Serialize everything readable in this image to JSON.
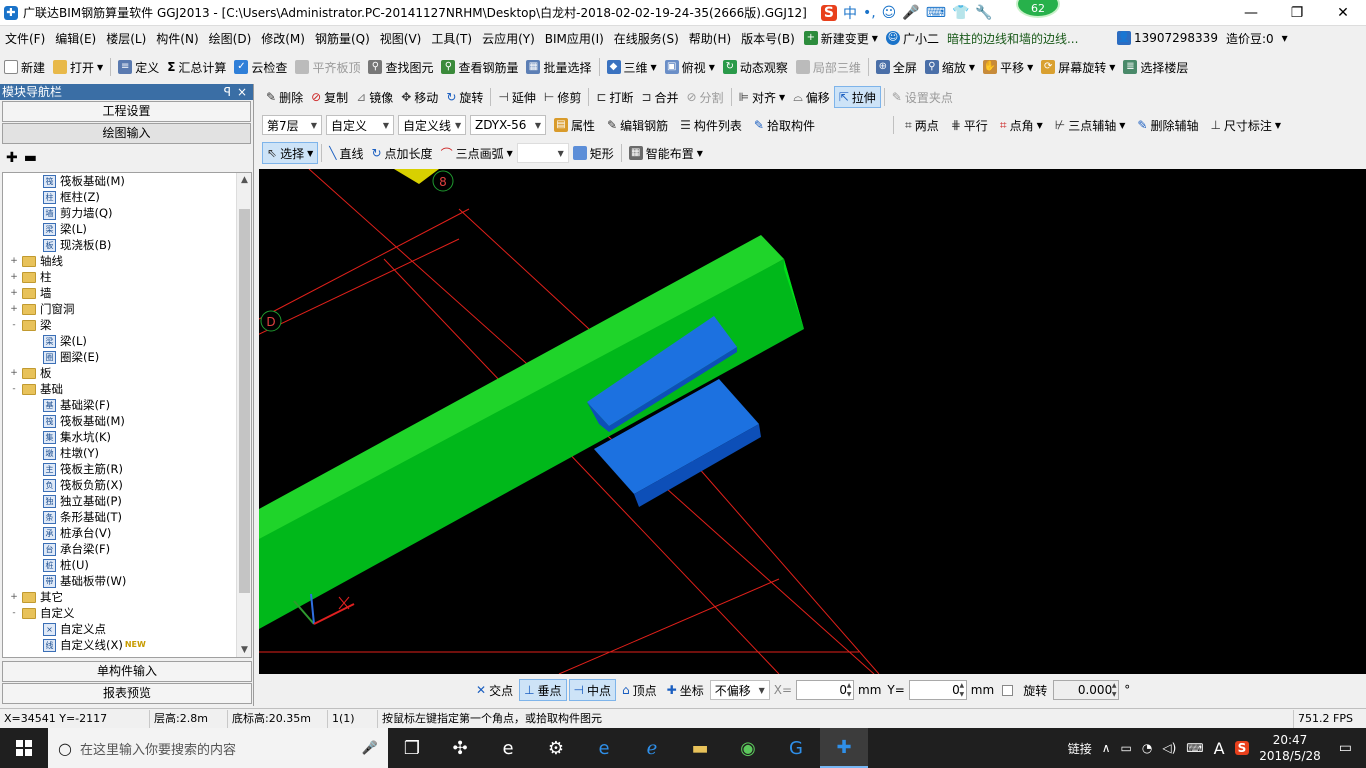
{
  "title": {
    "text": "广联达BIM钢筋算量软件 GGJ2013 - [C:\\Users\\Administrator.PC-20141127NRHM\\Desktop\\白龙村-2018-02-02-19-24-35(2666版).GGJ12]",
    "badge": "62",
    "ime_icons": [
      "S",
      "中",
      "•,",
      "☺",
      "🎤",
      "⌨",
      "👕",
      "🔧"
    ]
  },
  "menu": {
    "items": [
      "文件(F)",
      "编辑(E)",
      "楼层(L)",
      "构件(N)",
      "绘图(D)",
      "修改(M)",
      "钢筋量(Q)",
      "视图(V)",
      "工具(T)",
      "云应用(Y)",
      "BIM应用(I)",
      "在线服务(S)",
      "帮助(H)",
      "版本号(B)"
    ],
    "new_change": "新建变更",
    "guangxiaoer": "广小二",
    "marquee": "暗柱的边线和墙的边线...",
    "phone": "13907298339",
    "price_bean": "造价豆:0"
  },
  "toolbar1": {
    "new": "新建",
    "open": "打开",
    "define": "定义",
    "sum": "汇总计算",
    "cloud_check": "云检查",
    "flush_top": "平齐板顶",
    "find_elem": "查找图元",
    "view_steel": "查看钢筋量",
    "batch_select": "批量选择",
    "view3d": "三维",
    "top_view": "俯视",
    "dynamic_view": "动态观察",
    "local3d": "局部三维",
    "fullscreen": "全屏",
    "zoom": "缩放",
    "pan": "平移",
    "screen_rotate": "屏幕旋转",
    "select_floor": "选择楼层"
  },
  "panel": {
    "header": "模块导航栏",
    "pin": "ꟼ",
    "close": "×",
    "btn_project": "工程设置",
    "btn_drawing": "绘图输入",
    "btn_single": "单构件输入",
    "btn_report": "报表预览",
    "tree": [
      {
        "level": 2,
        "type": "item",
        "icon": "筏",
        "label": "筏板基础(M)"
      },
      {
        "level": 2,
        "type": "item",
        "icon": "柱",
        "label": "框柱(Z)"
      },
      {
        "level": 2,
        "type": "item",
        "icon": "墙",
        "label": "剪力墙(Q)"
      },
      {
        "level": 2,
        "type": "item",
        "icon": "梁",
        "label": "梁(L)"
      },
      {
        "level": 2,
        "type": "item",
        "icon": "板",
        "label": "现浇板(B)"
      },
      {
        "level": 1,
        "type": "folder",
        "expand": "+",
        "label": "轴线"
      },
      {
        "level": 1,
        "type": "folder",
        "expand": "+",
        "label": "柱"
      },
      {
        "level": 1,
        "type": "folder",
        "expand": "+",
        "label": "墙"
      },
      {
        "level": 1,
        "type": "folder",
        "expand": "+",
        "label": "门窗洞"
      },
      {
        "level": 1,
        "type": "folder",
        "expand": "-",
        "label": "梁"
      },
      {
        "level": 2,
        "type": "item",
        "icon": "梁",
        "label": "梁(L)"
      },
      {
        "level": 2,
        "type": "item",
        "icon": "圈",
        "label": "圈梁(E)"
      },
      {
        "level": 1,
        "type": "folder",
        "expand": "+",
        "label": "板"
      },
      {
        "level": 1,
        "type": "folder",
        "expand": "-",
        "label": "基础"
      },
      {
        "level": 2,
        "type": "item",
        "icon": "基",
        "label": "基础梁(F)"
      },
      {
        "level": 2,
        "type": "item",
        "icon": "筏",
        "label": "筏板基础(M)"
      },
      {
        "level": 2,
        "type": "item",
        "icon": "集",
        "label": "集水坑(K)"
      },
      {
        "level": 2,
        "type": "item",
        "icon": "墩",
        "label": "柱墩(Y)"
      },
      {
        "level": 2,
        "type": "item",
        "icon": "主",
        "label": "筏板主筋(R)"
      },
      {
        "level": 2,
        "type": "item",
        "icon": "负",
        "label": "筏板负筋(X)"
      },
      {
        "level": 2,
        "type": "item",
        "icon": "独",
        "label": "独立基础(P)"
      },
      {
        "level": 2,
        "type": "item",
        "icon": "条",
        "label": "条形基础(T)"
      },
      {
        "level": 2,
        "type": "item",
        "icon": "承",
        "label": "桩承台(V)"
      },
      {
        "level": 2,
        "type": "item",
        "icon": "台",
        "label": "承台梁(F)"
      },
      {
        "level": 2,
        "type": "item",
        "icon": "桩",
        "label": "桩(U)"
      },
      {
        "level": 2,
        "type": "item",
        "icon": "带",
        "label": "基础板带(W)"
      },
      {
        "level": 1,
        "type": "folder",
        "expand": "+",
        "label": "其它"
      },
      {
        "level": 1,
        "type": "folder",
        "expand": "-",
        "label": "自定义"
      },
      {
        "level": 2,
        "type": "item",
        "icon": "×",
        "label": "自定义点"
      },
      {
        "level": 2,
        "type": "item",
        "icon": "线",
        "label": "自定义线(X)",
        "new": "NEW"
      }
    ]
  },
  "toolbar2": {
    "delete": "删除",
    "copy": "复制",
    "mirror": "镜像",
    "move": "移动",
    "rotate": "旋转",
    "extend": "延伸",
    "trim": "修剪",
    "break": "打断",
    "merge": "合并",
    "split": "分割",
    "align": "对齐",
    "offset": "偏移",
    "stretch": "拉伸",
    "set_grip": "设置夹点"
  },
  "toolbar3": {
    "floor": "第7层",
    "type1": "自定义",
    "type2": "自定义线",
    "name": "ZDYX-56",
    "property": "属性",
    "edit_steel": "编辑钢筋",
    "component_list": "构件列表",
    "pick": "拾取构件",
    "two_point": "两点",
    "parallel": "平行",
    "point_angle": "点角",
    "three_point_aux": "三点辅轴",
    "delete_aux": "删除辅轴",
    "dimension": "尺寸标注"
  },
  "toolbar4": {
    "select": "选择",
    "line": "直线",
    "point_len": "点加长度",
    "arc3": "三点画弧",
    "blank": "",
    "rect": "矩形",
    "smart": "智能布置"
  },
  "viewport": {
    "axis_labels": [
      "8",
      "D"
    ]
  },
  "snapbar": {
    "intersect": "交点",
    "perp": "垂点",
    "mid": "中点",
    "vertex": "顶点",
    "coord": "坐标",
    "offset_mode": "不偏移",
    "x_label": "X=",
    "x_val": "0",
    "unit1": "mm",
    "y_label": "Y=",
    "y_val": "0",
    "unit2": "mm",
    "rotate_label": "旋转",
    "rotate_val": "0.000",
    "deg": "°"
  },
  "status": {
    "coords": "X=34541  Y=-2117",
    "floor_height": "层高:2.8m",
    "base_height": "底标高:20.35m",
    "count": "1(1)",
    "hint": "按鼠标左键指定第一个角点，或拾取构件图元",
    "fps": "751.2 FPS"
  },
  "taskbar": {
    "search_placeholder": "在这里输入你要搜索的内容",
    "link": "链接",
    "ime": "A",
    "time": "20:47",
    "date": "2018/5/28"
  },
  "colors": {
    "beam": "#00e01a",
    "slab": "#1565d8",
    "grid": "#e0201a",
    "accent": "#3a6ea5"
  }
}
